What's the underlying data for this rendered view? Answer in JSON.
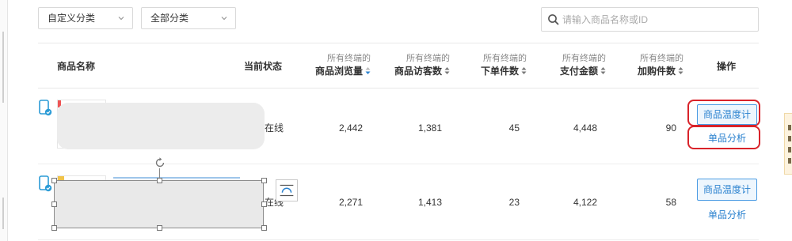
{
  "filters": {
    "custom_category": "自定义分类",
    "all_category": "全部分类"
  },
  "search": {
    "placeholder": "请输入商品名称或ID"
  },
  "table": {
    "headers": {
      "product_name": "商品名称",
      "status": "当前状态",
      "all_terminals": "所有终端的",
      "views": "商品浏览量",
      "visitors": "商品访客数",
      "orders": "下单件数",
      "payment": "支付金额",
      "cart": "加购件数",
      "action": "操作"
    },
    "rows": [
      {
        "status": "在线",
        "views": "2,442",
        "visitors": "1,381",
        "orders": "45",
        "payment": "4,448",
        "cart": "90",
        "temp_button": "商品温度计",
        "analysis_link": "单品分析"
      },
      {
        "status": "在线",
        "views": "2,271",
        "visitors": "1,413",
        "orders": "23",
        "payment": "4,122",
        "cart": "58",
        "temp_button": "商品温度计",
        "analysis_link": "单品分析"
      }
    ]
  },
  "colors": {
    "accent": "#2b82cf",
    "highlight_ring": "#d9232a",
    "button_fill": "#eef6fd"
  }
}
